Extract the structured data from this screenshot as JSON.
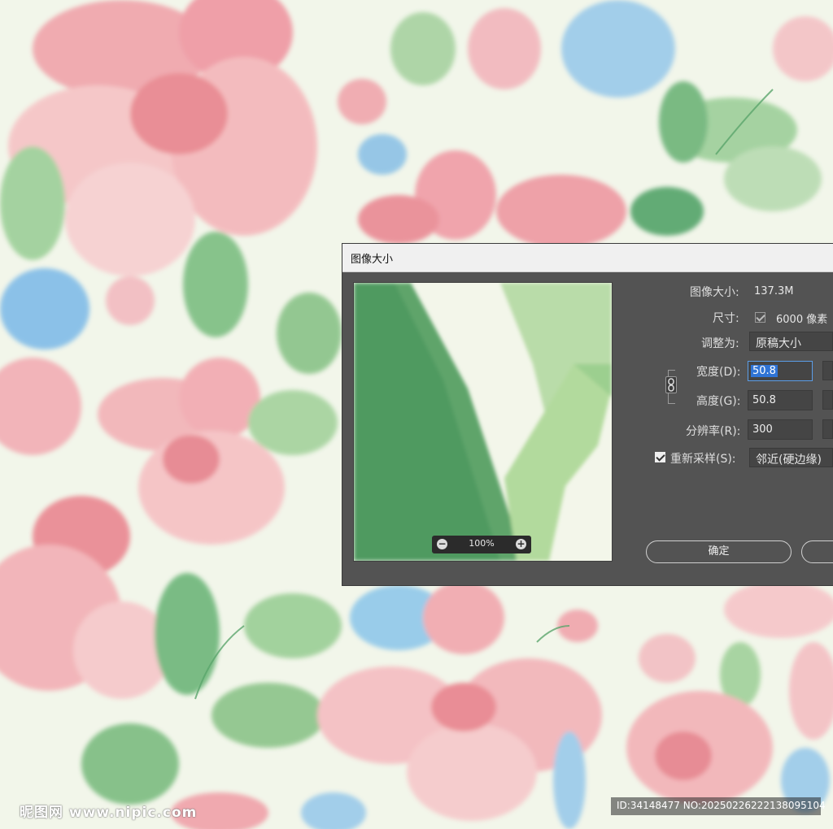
{
  "dialog": {
    "title": "图像大小",
    "image_size_label": "图像大小:",
    "image_size_value": "137.3M",
    "dimensions_label": "尺寸:",
    "dimensions_value": "6000 像素",
    "fit_to_label": "调整为:",
    "fit_to_value": "原稿大小",
    "width_label": "宽度(D):",
    "width_value": "50.8",
    "height_label": "高度(G):",
    "height_value": "50.8",
    "resolution_label": "分辨率(R):",
    "resolution_value": "300",
    "resample_label": "重新采样(S):",
    "resample_checked": true,
    "resample_value": "邻近(硬边缘)",
    "ok_label": "确定",
    "preview_zoom": "100%"
  },
  "watermark": {
    "site": "昵图网 www.nipic.com",
    "id_text": "ID:34148477 NO:20250226222138095104"
  },
  "colors": {
    "dialog_bg": "#535353",
    "field_bg": "#454545",
    "accent": "#2f74d6",
    "background": "#f2f6ea"
  }
}
